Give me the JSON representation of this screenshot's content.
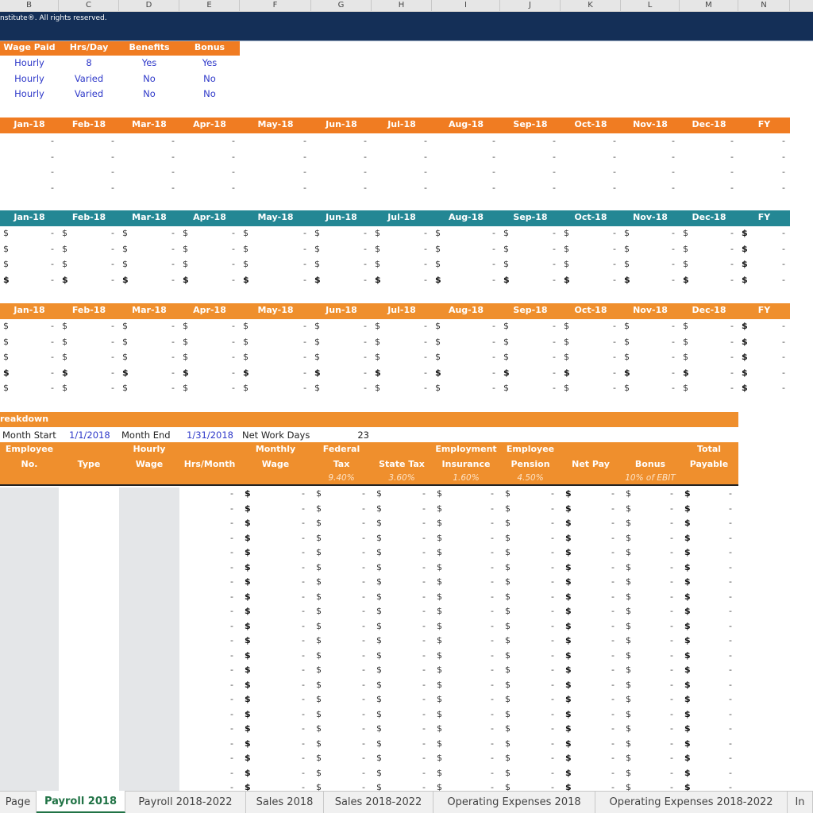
{
  "columns": [
    "B",
    "C",
    "D",
    "E",
    "F",
    "G",
    "H",
    "I",
    "J",
    "K",
    "L",
    "M",
    "N"
  ],
  "banner": {
    "copyright": "nstitute®. All rights reserved."
  },
  "employee_types": {
    "headers": [
      "Wage Paid",
      "Hrs/Day",
      "Benefits",
      "Bonus"
    ],
    "rows": [
      [
        "Hourly",
        "8",
        "Yes",
        "Yes"
      ],
      [
        "Hourly",
        "Varied",
        "No",
        "No"
      ],
      [
        "Hourly",
        "Varied",
        "No",
        "No"
      ]
    ]
  },
  "months": [
    "Jan-18",
    "Feb-18",
    "Mar-18",
    "Apr-18",
    "May-18",
    "Jun-18",
    "Jul-18",
    "Aug-18",
    "Sep-18",
    "Oct-18",
    "Nov-18",
    "Dec-18",
    "FY"
  ],
  "section1": {
    "rows": 4,
    "empty_value": "-"
  },
  "section2": {
    "rows": 4,
    "currency": "$",
    "empty_value": "-",
    "bold_rows": [
      3
    ]
  },
  "section3": {
    "rows": 5,
    "currency": "$",
    "empty_value": "-",
    "bold_rows": [
      3
    ]
  },
  "breakdown": {
    "title": "reakdown",
    "month_start_label": "Month Start",
    "month_start": "1/1/2018",
    "month_end_label": "Month End",
    "month_end": "1/31/2018",
    "net_work_days_label": "Net Work Days",
    "net_work_days": "23",
    "headers": [
      {
        "line1": "Employee",
        "line2": "No.",
        "rate": ""
      },
      {
        "line1": "",
        "line2": "Type",
        "rate": ""
      },
      {
        "line1": "Hourly",
        "line2": "Wage",
        "rate": ""
      },
      {
        "line1": "",
        "line2": "Hrs/Month",
        "rate": ""
      },
      {
        "line1": "Monthly",
        "line2": "Wage",
        "rate": ""
      },
      {
        "line1": "Federal",
        "line2": "Tax",
        "rate": "9.40%"
      },
      {
        "line1": "",
        "line2": "State Tax",
        "rate": "3.60%"
      },
      {
        "line1": "Employment",
        "line2": "Insurance",
        "rate": "1.60%"
      },
      {
        "line1": "Employee",
        "line2": "Pension",
        "rate": "4.50%"
      },
      {
        "line1": "",
        "line2": "Net Pay",
        "rate": ""
      },
      {
        "line1": "",
        "line2": "Bonus",
        "rate": "10% of EBIT"
      },
      {
        "line1": "Total",
        "line2": "Payable",
        "rate": ""
      }
    ],
    "row_count": 21,
    "currency": "$",
    "empty_value": "-"
  },
  "sheet_tabs": [
    {
      "label": "Page",
      "active": false
    },
    {
      "label": "Payroll 2018",
      "active": true
    },
    {
      "label": "Payroll 2018-2022",
      "active": false
    },
    {
      "label": "Sales 2018",
      "active": false
    },
    {
      "label": "Sales 2018-2022",
      "active": false
    },
    {
      "label": "Operating Expenses 2018",
      "active": false
    },
    {
      "label": "Operating Expenses 2018-2022",
      "active": false
    },
    {
      "label": "In",
      "active": false
    }
  ],
  "colors": {
    "banner": "#142f57",
    "orange_header": "#f07c22",
    "teal_header": "#248794",
    "input_blue": "#2f39c9",
    "active_tab": "#217346"
  }
}
